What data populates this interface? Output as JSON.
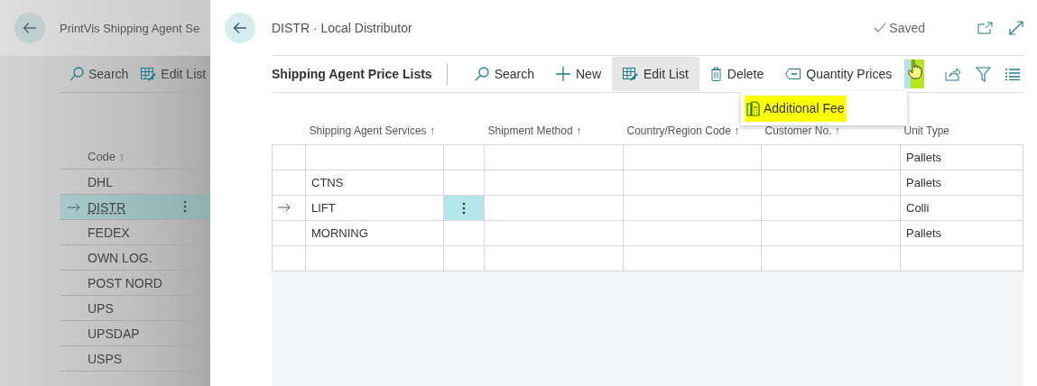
{
  "background_page": {
    "title": "PrintVis Shipping Agent Se",
    "toolbar": [
      {
        "kind": "search",
        "label": "Search"
      },
      {
        "kind": "edit",
        "label": "Edit List"
      }
    ],
    "column_header": "Code ↑",
    "rows": [
      {
        "code": "DHL",
        "selected": false
      },
      {
        "code": "DISTR",
        "selected": true
      },
      {
        "code": "FEDEX",
        "selected": false
      },
      {
        "code": "OWN LOG.",
        "selected": false
      },
      {
        "code": "POST NORD",
        "selected": false
      },
      {
        "code": "UPS",
        "selected": false
      },
      {
        "code": "UPSDAP",
        "selected": false
      },
      {
        "code": "USPS",
        "selected": false
      }
    ]
  },
  "card": {
    "title": "DISTR · Local Distributor",
    "status": "Saved",
    "part_title": "Shipping Agent Price Lists",
    "actions": [
      {
        "kind": "search",
        "label": "Search",
        "selected": false
      },
      {
        "kind": "new",
        "label": "New",
        "selected": false
      },
      {
        "kind": "edit",
        "label": "Edit List",
        "selected": true
      },
      {
        "kind": "delete",
        "label": "Delete",
        "selected": false
      },
      {
        "kind": "prices",
        "label": "Quantity Prices",
        "selected": false
      }
    ],
    "more_menu": {
      "expanded": true,
      "items": [
        {
          "label": "Additional Fee",
          "highlighted": true
        }
      ]
    },
    "table": {
      "columns": [
        "Shipping Agent Services ↑",
        "",
        "Shipment Method ↑",
        "Country/Region Code ↑",
        "Customer No. ↑",
        "Unit Type"
      ],
      "rows": [
        {
          "service": "",
          "unit_type": "Pallets",
          "current": false
        },
        {
          "service": "CTNS",
          "unit_type": "Pallets",
          "current": false
        },
        {
          "service": "LIFT",
          "unit_type": "Colli",
          "current": true
        },
        {
          "service": "MORNING",
          "unit_type": "Pallets",
          "current": false
        },
        {
          "service": "",
          "unit_type": "",
          "current": false
        }
      ]
    }
  }
}
